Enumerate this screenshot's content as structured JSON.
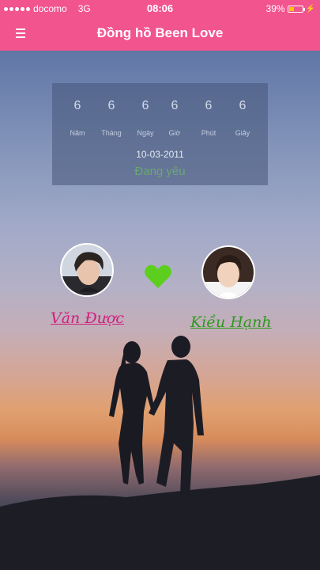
{
  "status_bar": {
    "carrier": "docomo",
    "network": "3G",
    "time": "08:06",
    "battery_text": "39%",
    "battery_level": 0.39,
    "battery_color": "#f5c800"
  },
  "app_bar": {
    "title": "Đồng hồ Been Love",
    "menu_icon": "hamburger-menu-icon",
    "color": "#f2548d"
  },
  "counter": {
    "units": [
      {
        "value": "6",
        "label": "Năm"
      },
      {
        "value": "6",
        "label": "Tháng"
      },
      {
        "value": "6",
        "label": "Ngày"
      },
      {
        "value": "6",
        "label": "Giờ"
      },
      {
        "value": "6",
        "label": "Phút"
      },
      {
        "value": "6",
        "label": "Giây"
      }
    ],
    "start_date": "10-03-2011",
    "status": "Đang yêu"
  },
  "couple": {
    "left_name": "Văn Được",
    "right_name": "Kiều Hạnh",
    "heart_icon": "heart-icon",
    "heart_color": "#5ccf1e",
    "left_name_color": "#d11f7f",
    "right_name_color": "#2d9a1f"
  }
}
